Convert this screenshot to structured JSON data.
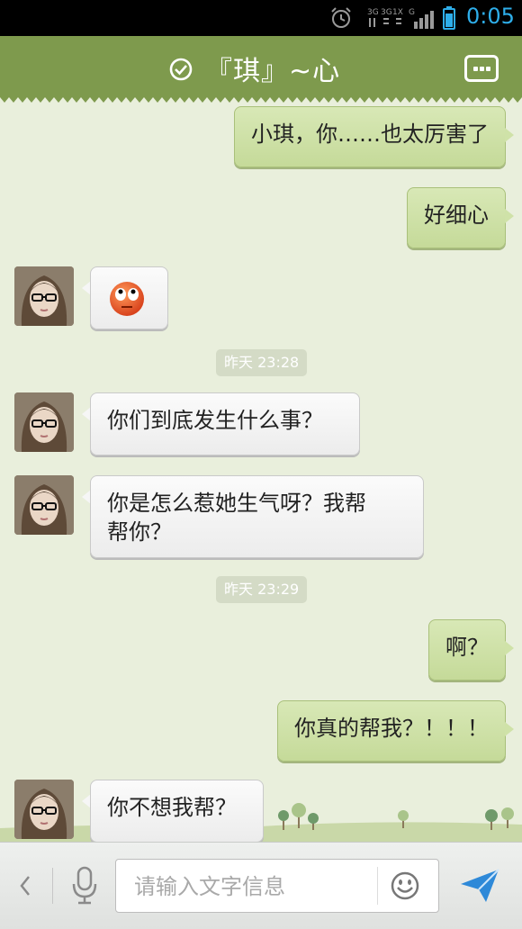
{
  "status_bar": {
    "time": "0:05",
    "network_labels": [
      "3G",
      "3G",
      "1X",
      "G"
    ],
    "accent_color": "#2eaeea"
  },
  "header": {
    "title": "『琪』~心",
    "status_icon": "check-circle-icon",
    "menu_icon": "more-options-icon",
    "bg_color": "#7e9a4d"
  },
  "messages": [
    {
      "side": "out",
      "text": "小琪，你……也太厉害了"
    },
    {
      "side": "out",
      "text": "好细心"
    },
    {
      "side": "in",
      "emoji": "rolling-eyes-emoji"
    },
    {
      "type": "timestamp",
      "text": "昨天 23:28"
    },
    {
      "side": "in",
      "text": "你们到底发生什么事？"
    },
    {
      "side": "in",
      "line1": "你是怎么惹她生气呀？我帮",
      "line2": "帮你？"
    },
    {
      "type": "timestamp",
      "text": "昨天 23:29"
    },
    {
      "side": "out",
      "text": "啊？"
    },
    {
      "side": "out",
      "text": "你真的帮我？！！！"
    },
    {
      "side": "in",
      "text": "你不想我帮？"
    }
  ],
  "input_bar": {
    "placeholder": "请输入文字信息",
    "back_icon": "chevron-left-icon",
    "voice_icon": "microphone-icon",
    "emoji_icon": "smiley-icon",
    "send_icon": "send-arrow-icon"
  }
}
